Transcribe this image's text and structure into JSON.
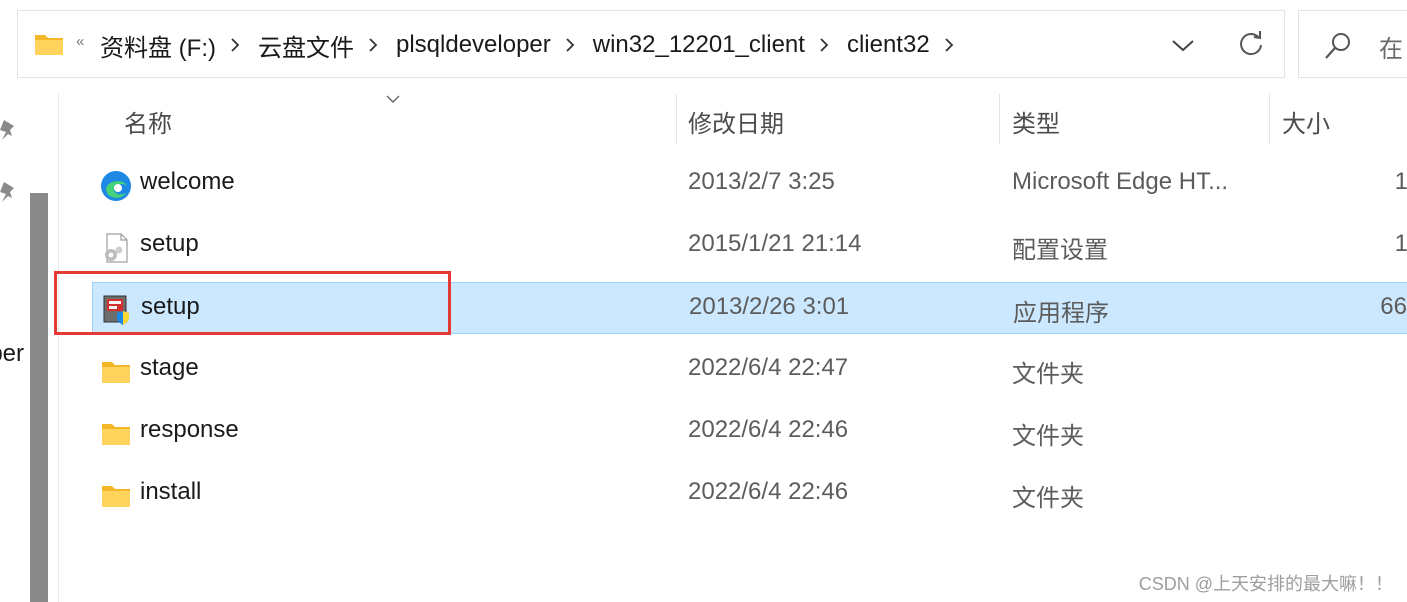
{
  "address_bar": {
    "overflow_glyph": "«",
    "path": [
      "资料盘 (F:)",
      "云盘文件",
      "plsqldeveloper",
      "win32_12201_client",
      "client32"
    ],
    "icons": [
      "folder-icon",
      "chevron-right-icon",
      "chevron-down-icon",
      "refresh-icon"
    ]
  },
  "search": {
    "placeholder": "在",
    "icon": "search-icon"
  },
  "nav_pane": {
    "partial_text": "per",
    "icons": [
      "pin-icon",
      "pin-icon"
    ]
  },
  "columns": {
    "name": "名称",
    "date": "修改日期",
    "type": "类型",
    "size": "大小"
  },
  "files": [
    {
      "name": "welcome",
      "date": "2013/2/7 3:25",
      "type": "Microsoft Edge HT...",
      "size": "1",
      "icon": "edge-html-icon",
      "selected": false
    },
    {
      "name": "setup",
      "date": "2015/1/21 21:14",
      "type": "配置设置",
      "size": "1",
      "icon": "settings-file-icon",
      "selected": false
    },
    {
      "name": "setup",
      "date": "2013/2/26 3:01",
      "type": "应用程序",
      "size": "66",
      "icon": "installer-exe-icon",
      "selected": true
    },
    {
      "name": "stage",
      "date": "2022/6/4 22:47",
      "type": "文件夹",
      "size": "",
      "icon": "folder-icon",
      "selected": false
    },
    {
      "name": "response",
      "date": "2022/6/4 22:46",
      "type": "文件夹",
      "size": "",
      "icon": "folder-icon",
      "selected": false
    },
    {
      "name": "install",
      "date": "2022/6/4 22:46",
      "type": "文件夹",
      "size": "",
      "icon": "folder-icon",
      "selected": false
    }
  ],
  "watermark": "CSDN @上天安排的最大嘛！！",
  "colors": {
    "selection": "#cce8ff",
    "selection_border": "#99d1ff",
    "annotation_box": "#e53935",
    "folder": "#f8c83c"
  }
}
